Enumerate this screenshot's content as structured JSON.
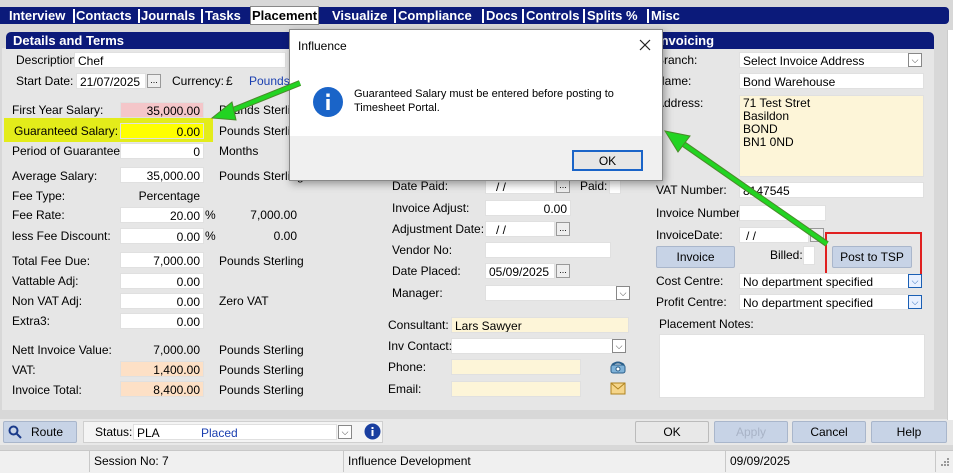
{
  "tabs": [
    "Interview",
    "Contacts",
    "Journals",
    "Tasks",
    "Placement",
    "Visualize",
    "Compliance",
    "Docs",
    "Controls",
    "Splits %",
    "Misc"
  ],
  "active_tab": "Placement",
  "left": {
    "header": "Details and Terms",
    "description_label": "Description:",
    "description_value": "Chef",
    "start_date_label": "Start Date:",
    "start_date_value": "21/07/2025",
    "currency_label": "Currency:",
    "currency_symbol": "£",
    "currency_value": "Pounds",
    "first_year_salary_label": "First Year Salary:",
    "first_year_salary_value": "35,000.00",
    "first_year_salary_unit": "Pounds Sterling",
    "guaranteed_salary_label": "Guaranteed Salary:",
    "guaranteed_salary_value": "0.00",
    "guaranteed_salary_unit": "Pounds Sterling",
    "period_label": "Period of Guarantee:",
    "period_value": "0",
    "period_unit": "Months",
    "avg_salary_label": "Average Salary:",
    "avg_salary_value": "35,000.00",
    "avg_salary_unit": "Pounds Sterling",
    "fee_type_label": "Fee Type:",
    "fee_type_value": "Percentage",
    "fee_rate_label": "Fee Rate:",
    "fee_rate_value": "20.00",
    "fee_rate_pct": "%",
    "fee_rate_amount": "7,000.00",
    "less_fee_label": "less Fee Discount:",
    "less_fee_value": "0.00",
    "less_fee_pct": "%",
    "less_fee_amount": "0.00",
    "total_fee_label": "Total Fee Due:",
    "total_fee_value": "7,000.00",
    "total_fee_unit": "Pounds Sterling",
    "vattable_label": "Vattable Adj:",
    "vattable_value": "0.00",
    "nonvat_label": "Non VAT Adj:",
    "nonvat_value": "0.00",
    "nonvat_unit": "Zero VAT",
    "extra3_label": "Extra3:",
    "extra3_value": "0.00",
    "nett_label": "Nett Invoice Value:",
    "nett_value": "7,000.00",
    "nett_unit": "Pounds Sterling",
    "vat_label": "VAT:",
    "vat_value": "1,400.00",
    "vat_unit": "Pounds Sterling",
    "invoice_total_label": "Invoice Total:",
    "invoice_total_value": "8,400.00",
    "invoice_total_unit": "Pounds Sterling"
  },
  "middle": {
    "date_paid_label": "Date Paid:",
    "date_paid_value": "/   /",
    "paid_label": "Paid:",
    "invoice_adjust_label": "Invoice Adjust:",
    "invoice_adjust_value": "0.00",
    "adjustment_date_label": "Adjustment Date:",
    "adjustment_date_value": "/   /",
    "vendor_label": "Vendor No:",
    "date_placed_label": "Date Placed:",
    "date_placed_value": "05/09/2025",
    "manager_label": "Manager:",
    "consultant_label": "Consultant:",
    "consultant_value": "Lars Sawyer",
    "inv_contact_label": "Inv Contact:",
    "phone_label": "Phone:",
    "email_label": "Email:"
  },
  "right": {
    "header": "Invoicing",
    "branch_label": "Branch:",
    "branch_value": "Select Invoice Address",
    "name_label": "Name:",
    "name_value": "Bond Warehouse",
    "address_label": "Address:",
    "address_lines": [
      "71 Test Stret",
      "Basildon",
      "BOND",
      "BN1 0ND"
    ],
    "vat_number_label": "VAT Number:",
    "vat_number_value": "8147545",
    "invoice_number_label": "Invoice Number:",
    "invoice_date_label": "InvoiceDate:",
    "invoice_date_value": "/   /",
    "invoice_button": "Invoice",
    "billed_label": "Billed:",
    "post_tsp_button": "Post to TSP",
    "cost_centre_label": "Cost Centre:",
    "cost_centre_value": "No department specified",
    "profit_centre_label": "Profit Centre:",
    "profit_centre_value": "No department specified",
    "notes_label": "Placement Notes:"
  },
  "bottom": {
    "route_button": "Route",
    "status_label": "Status:",
    "status_code": "PLA",
    "status_value": "Placed",
    "ok_button": "OK",
    "apply_button": "Apply",
    "cancel_button": "Cancel",
    "help_button": "Help"
  },
  "statusbar": {
    "session": "Session No: 7",
    "app": "Influence Development",
    "date": "09/09/2025"
  },
  "dialog": {
    "title": "Influence",
    "message_line1": "Guaranteed Salary must be entered before posting to",
    "message_line2": "Timesheet Portal.",
    "ok_button": "OK"
  },
  "colors": {
    "navy": "#0b1a7a",
    "highlight": "#e3ec1a",
    "arrow": "#22d422",
    "red_box": "#e02020",
    "info": "#1a64c8"
  }
}
